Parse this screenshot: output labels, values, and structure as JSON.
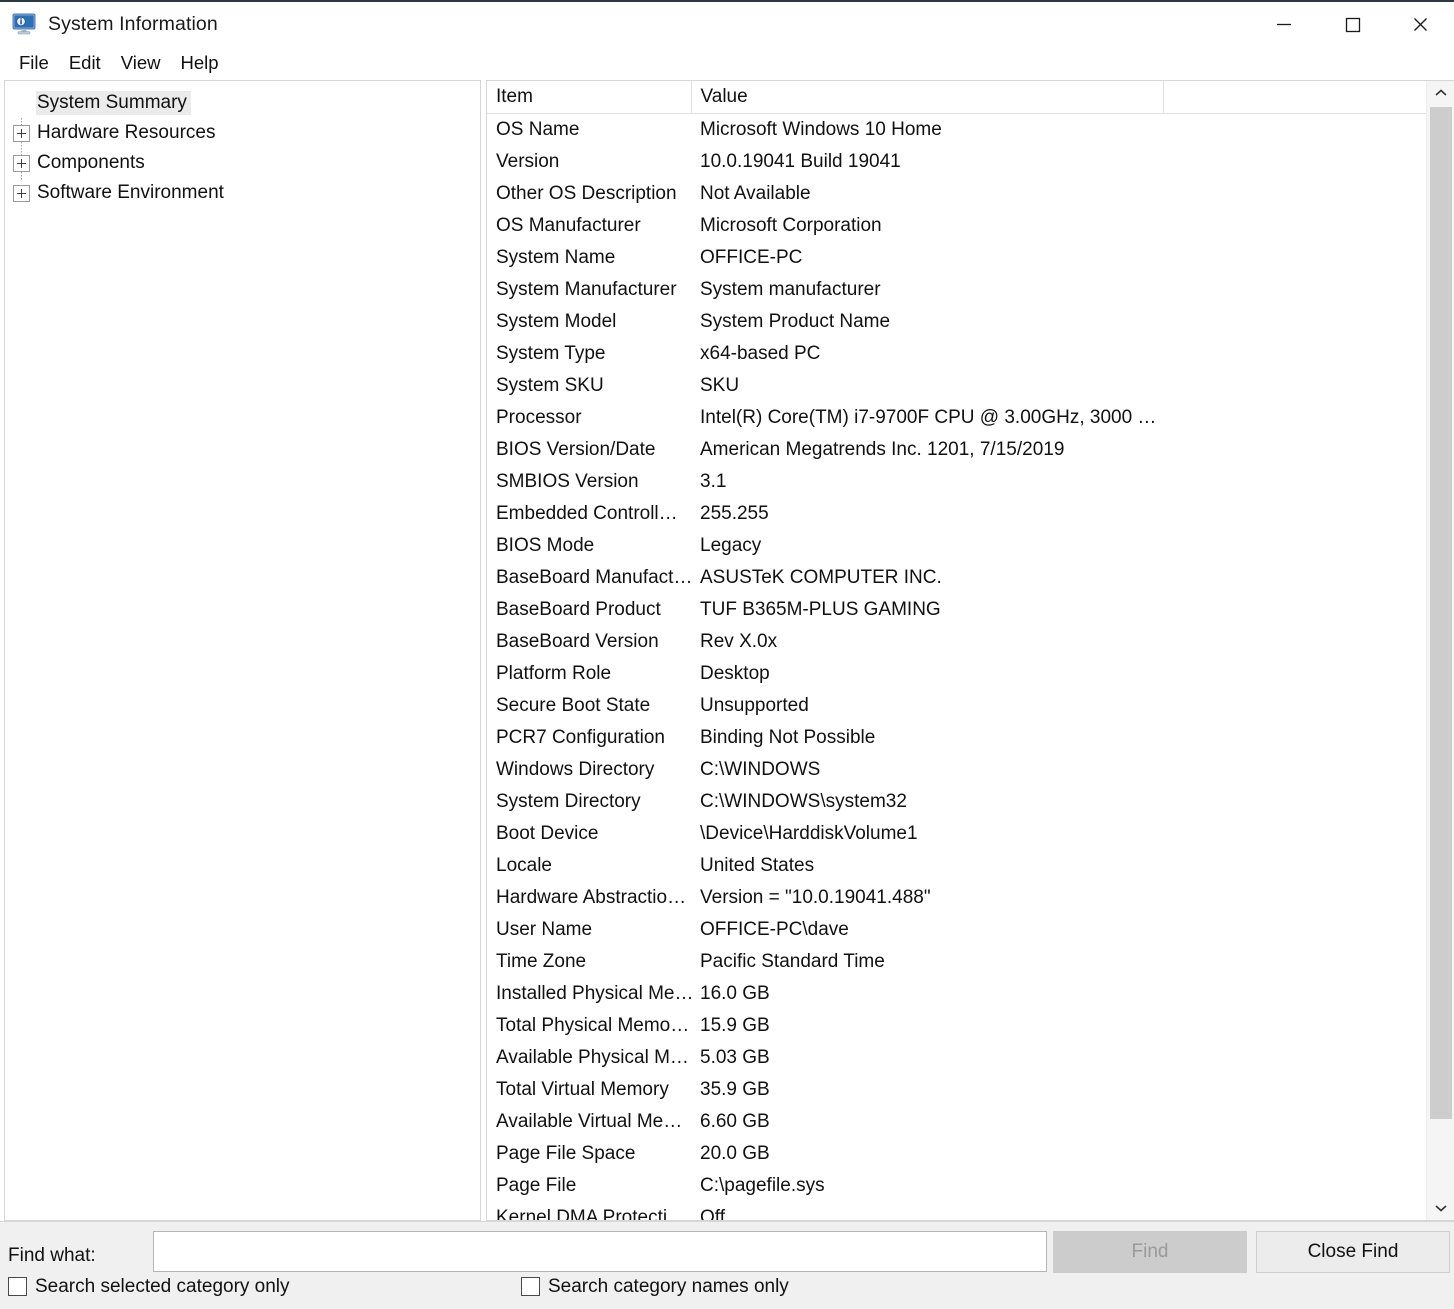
{
  "window": {
    "title": "System Information",
    "icon": "system-information-icon",
    "controls": {
      "minimize": "minimize-icon",
      "maximize": "maximize-icon",
      "close": "close-icon"
    },
    "accent_border": "#2b3a42"
  },
  "menubar": {
    "items": [
      {
        "label": "File"
      },
      {
        "label": "Edit"
      },
      {
        "label": "View"
      },
      {
        "label": "Help"
      }
    ]
  },
  "tree": {
    "selected": "System Summary",
    "items": [
      {
        "label": "System Summary",
        "expandable": false,
        "selected": true
      },
      {
        "label": "Hardware Resources",
        "expandable": true,
        "selected": false
      },
      {
        "label": "Components",
        "expandable": true,
        "selected": false
      },
      {
        "label": "Software Environment",
        "expandable": true,
        "selected": false
      }
    ]
  },
  "list": {
    "columns": [
      "Item",
      "Value"
    ],
    "rows": [
      {
        "item": "OS Name",
        "value": "Microsoft Windows 10 Home"
      },
      {
        "item": "Version",
        "value": "10.0.19041 Build 19041"
      },
      {
        "item": "Other OS Description",
        "value": "Not Available"
      },
      {
        "item": "OS Manufacturer",
        "value": "Microsoft Corporation"
      },
      {
        "item": "System Name",
        "value": "OFFICE-PC"
      },
      {
        "item": "System Manufacturer",
        "value": "System manufacturer"
      },
      {
        "item": "System Model",
        "value": "System Product Name"
      },
      {
        "item": "System Type",
        "value": "x64-based PC"
      },
      {
        "item": "System SKU",
        "value": "SKU"
      },
      {
        "item": "Processor",
        "value": "Intel(R) Core(TM) i7-9700F CPU @ 3.00GHz, 3000 …"
      },
      {
        "item": "BIOS Version/Date",
        "value": "American Megatrends Inc. 1201, 7/15/2019"
      },
      {
        "item": "SMBIOS Version",
        "value": "3.1"
      },
      {
        "item": "Embedded Controll…",
        "value": "255.255"
      },
      {
        "item": "BIOS Mode",
        "value": "Legacy"
      },
      {
        "item": "BaseBoard Manufact…",
        "value": "ASUSTeK COMPUTER INC."
      },
      {
        "item": "BaseBoard Product",
        "value": "TUF B365M-PLUS GAMING"
      },
      {
        "item": "BaseBoard Version",
        "value": "Rev X.0x"
      },
      {
        "item": "Platform Role",
        "value": "Desktop"
      },
      {
        "item": "Secure Boot State",
        "value": "Unsupported"
      },
      {
        "item": "PCR7 Configuration",
        "value": "Binding Not Possible"
      },
      {
        "item": "Windows Directory",
        "value": "C:\\WINDOWS"
      },
      {
        "item": "System Directory",
        "value": "C:\\WINDOWS\\system32"
      },
      {
        "item": "Boot Device",
        "value": "\\Device\\HarddiskVolume1"
      },
      {
        "item": "Locale",
        "value": "United States"
      },
      {
        "item": "Hardware Abstractio…",
        "value": "Version = \"10.0.19041.488\""
      },
      {
        "item": "User Name",
        "value": "OFFICE-PC\\dave"
      },
      {
        "item": "Time Zone",
        "value": "Pacific Standard Time"
      },
      {
        "item": "Installed Physical Me…",
        "value": "16.0 GB"
      },
      {
        "item": "Total Physical Memo…",
        "value": "15.9 GB"
      },
      {
        "item": "Available Physical M…",
        "value": "5.03 GB"
      },
      {
        "item": "Total Virtual Memory",
        "value": "35.9 GB"
      },
      {
        "item": "Available Virtual Me…",
        "value": "6.60 GB"
      },
      {
        "item": "Page File Space",
        "value": "20.0 GB"
      },
      {
        "item": "Page File",
        "value": "C:\\pagefile.sys"
      },
      {
        "item": "Kernel DMA Protecti…",
        "value": "Off"
      }
    ]
  },
  "scrollbar": {
    "up_icon": "chevron-up-icon",
    "down_icon": "chevron-down-icon"
  },
  "findbar": {
    "label": "Find what:",
    "input_value": "",
    "input_placeholder": "",
    "find_button": "Find",
    "find_button_enabled": false,
    "close_button": "Close Find",
    "checkbox_selected_category": {
      "label": "Search selected category only",
      "checked": false
    },
    "checkbox_category_names": {
      "label": "Search category names only",
      "checked": false
    }
  }
}
